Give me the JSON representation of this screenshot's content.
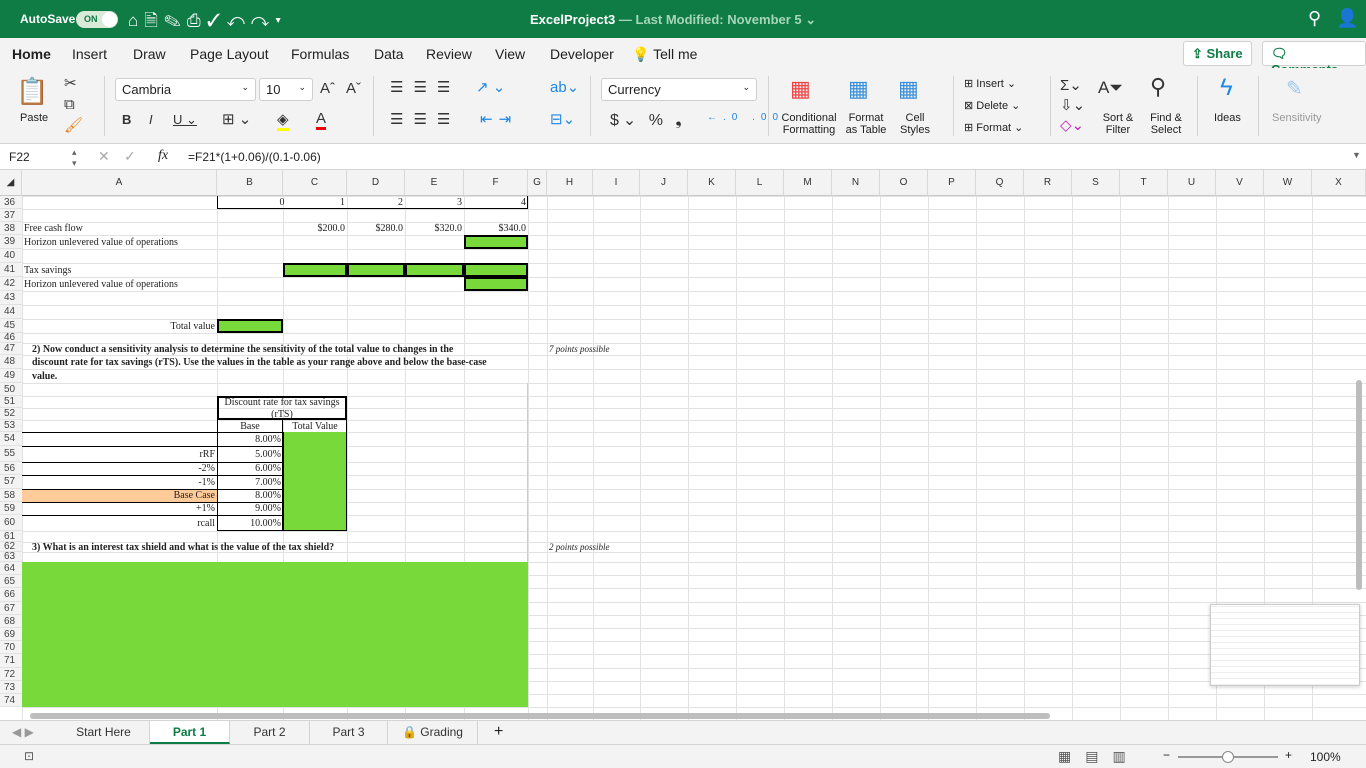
{
  "titlebar": {
    "autosave": "AutoSave",
    "toggle": "ON",
    "doc_name": "ExcelProject3",
    "modified": " — Last Modified: November 5 ⌄"
  },
  "tabs": [
    "Home",
    "Insert",
    "Draw",
    "Page Layout",
    "Formulas",
    "Data",
    "Review",
    "View",
    "Developer",
    "Tell me"
  ],
  "share": "Share",
  "comments": "Comments",
  "ribbon": {
    "paste": "Paste",
    "font": "Cambria",
    "size": "10",
    "number_format": "Currency",
    "conditional": "Conditional Formatting",
    "format_table": "Format as Table",
    "cell_styles": "Cell Styles",
    "insert": "Insert",
    "delete": "Delete",
    "format": "Format",
    "sort": "Sort & Filter",
    "find": "Find & Select",
    "ideas": "Ideas",
    "sensitivity": "Sensitivity"
  },
  "formula_bar": {
    "name_box": "F22",
    "formula": "=F21*(1+0.06)/(0.1-0.06)"
  },
  "columns": [
    "A",
    "B",
    "C",
    "D",
    "E",
    "F",
    "G",
    "H",
    "I",
    "J",
    "K",
    "L",
    "M",
    "N",
    "O",
    "P",
    "Q",
    "R",
    "S",
    "T",
    "U",
    "V",
    "W",
    "X"
  ],
  "first_row": 36,
  "last_row": 74,
  "colors": {
    "green_fill": "#77d93a",
    "orange_fill": "#ffcc99",
    "excel_green": "#0f7b45"
  },
  "cells": [
    {
      "ref": "B36",
      "value": "0",
      "align": "center"
    },
    {
      "ref": "C36",
      "value": "1",
      "align": "right"
    },
    {
      "ref": "D36",
      "value": "2",
      "align": "right"
    },
    {
      "ref": "E36",
      "value": "3",
      "align": "right"
    },
    {
      "ref": "F36",
      "value": "4",
      "align": "right"
    },
    {
      "ref": "A38",
      "value": "Free cash flow"
    },
    {
      "ref": "C38",
      "value": "$200.0",
      "align": "right"
    },
    {
      "ref": "D38",
      "value": "$280.0",
      "align": "right"
    },
    {
      "ref": "E38",
      "value": "$320.0",
      "align": "right"
    },
    {
      "ref": "F38",
      "value": "$340.0",
      "align": "right"
    },
    {
      "ref": "A39",
      "value": "Horizon unlevered value of operations"
    },
    {
      "ref": "A41",
      "value": "Tax savings"
    },
    {
      "ref": "A42",
      "value": "Horizon unlevered value of operations"
    },
    {
      "ref": "A45",
      "value": "Total value",
      "align": "right"
    },
    {
      "ref": "A47",
      "value": "2) Now conduct a sensitivity analysis to determine the sensitivity of the total value to changes in the",
      "bold": true
    },
    {
      "ref": "A48",
      "value": "discount rate for tax savings (rTS). Use the values in the table as your range above and below the base-case",
      "bold": true
    },
    {
      "ref": "A49",
      "value": "value.",
      "bold": true
    },
    {
      "ref": "H47",
      "value": "7 points possible",
      "italic": true
    },
    {
      "ref": "B51",
      "value": "Discount rate for tax savings",
      "align": "center"
    },
    {
      "ref": "B52",
      "value": "(rTS)",
      "align": "center"
    },
    {
      "ref": "B53",
      "value": "Base",
      "align": "center"
    },
    {
      "ref": "C53",
      "value": "Total Value",
      "align": "center"
    },
    {
      "ref": "B54",
      "value": "8.00%",
      "align": "right"
    },
    {
      "ref": "A55",
      "value": "rRF",
      "align": "right"
    },
    {
      "ref": "B55",
      "value": "5.00%",
      "align": "right"
    },
    {
      "ref": "A56",
      "value": "-2%",
      "align": "right"
    },
    {
      "ref": "B56",
      "value": "6.00%",
      "align": "right"
    },
    {
      "ref": "A57",
      "value": "-1%",
      "align": "right"
    },
    {
      "ref": "B57",
      "value": "7.00%",
      "align": "right"
    },
    {
      "ref": "A58",
      "value": "Base Case",
      "align": "right"
    },
    {
      "ref": "B58",
      "value": "8.00%",
      "align": "right"
    },
    {
      "ref": "A59",
      "value": "+1%",
      "align": "right"
    },
    {
      "ref": "B59",
      "value": "9.00%",
      "align": "right"
    },
    {
      "ref": "A60",
      "value": "rcall",
      "align": "right"
    },
    {
      "ref": "B60",
      "value": "10.00%",
      "align": "right"
    },
    {
      "ref": "A62",
      "value": "3) What is an interest tax shield and what is the value of the tax shield?",
      "bold": true
    },
    {
      "ref": "H62",
      "value": "2 points possible",
      "italic": true
    }
  ],
  "sheet_tabs": [
    "Start Here",
    "Part 1",
    "Part 2",
    "Part 3",
    "Grading"
  ],
  "active_sheet": "Part 1",
  "zoom": "100%"
}
